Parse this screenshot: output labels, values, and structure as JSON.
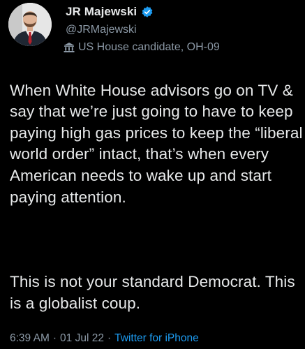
{
  "author": {
    "display_name": "JR Majewski",
    "handle": "@JRMajewski",
    "verified": true,
    "avatar_icon": "profile-photo",
    "label": {
      "icon": "government-building-icon",
      "text": "US House candidate, OH-09"
    }
  },
  "tweet": {
    "paragraph_1": "When White House advisors go on TV & say that we’re just going to have to keep paying high gas prices to keep the “liberal world order” intact, that’s when every American needs to wake up and start paying attention.",
    "paragraph_2": "This is not your standard Democrat. This is a globalist coup.",
    "time": "6:39 AM",
    "date": "01 Jul 22",
    "source": "Twitter for iPhone"
  },
  "colors": {
    "background": "#000000",
    "text": "#e7e9ea",
    "secondary": "#8b98a5",
    "link": "#1d9bf0",
    "verified": "#1d9bf0"
  }
}
